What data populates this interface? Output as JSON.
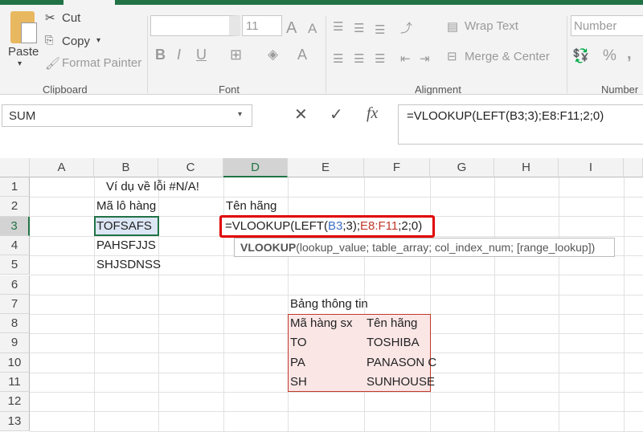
{
  "ribbon": {
    "clipboard": {
      "paste": "Paste",
      "cut": "Cut",
      "copy": "Copy",
      "format_painter": "Format Painter",
      "label": "Clipboard"
    },
    "font": {
      "font_name": "",
      "font_size": "11",
      "bold": "B",
      "italic": "I",
      "underline": "U",
      "font_color": "A",
      "label": "Font"
    },
    "alignment": {
      "wrap_text": "Wrap Text",
      "merge_center": "Merge & Center",
      "label": "Alignment"
    },
    "number": {
      "format": "Number",
      "percent": "%",
      "comma": ",",
      "label": "Number"
    }
  },
  "formula_bar": {
    "name_box": "SUM",
    "cancel": "✕",
    "enter": "✓",
    "fx": "fx",
    "formula": "=VLOOKUP(LEFT(B3;3);E8:F11;2;0)"
  },
  "columns": [
    "A",
    "B",
    "C",
    "D",
    "E",
    "F",
    "G",
    "H",
    "I"
  ],
  "rows": [
    "1",
    "2",
    "3",
    "4",
    "5",
    "6",
    "7",
    "8",
    "9",
    "10",
    "11",
    "12",
    "13"
  ],
  "cells": {
    "B1": "Ví dụ về lỗi #N/A!",
    "B2": "Mã lô hàng",
    "D2": "Tên hãng",
    "B3": "TOFSAFS",
    "B4": "PAHSFJJS",
    "B5": "SHJSDNSS",
    "E7": "Bảng thông tin",
    "E8": "Mã hàng sx",
    "F8": "Tên hãng",
    "E9": "TO",
    "F9": "TOSHIBA",
    "E10": "PA",
    "F10": "PANASON C",
    "E11": "SH",
    "F11": "SUNHOUSE"
  },
  "edit": {
    "p1": "=VLOOKUP(LEFT(",
    "p2": "B3",
    "p3": ";3);",
    "p4": "E8:F11",
    "p5": ";2;0)"
  },
  "tooltip": {
    "fn": "VLOOKUP",
    "args": "(lookup_value; table_array; col_index_num; [range_lookup])"
  },
  "colors": {
    "accent": "#217346",
    "ref_blue": "#3b6fc4",
    "ref_red": "#c0392b",
    "highlight": "#e00000"
  }
}
